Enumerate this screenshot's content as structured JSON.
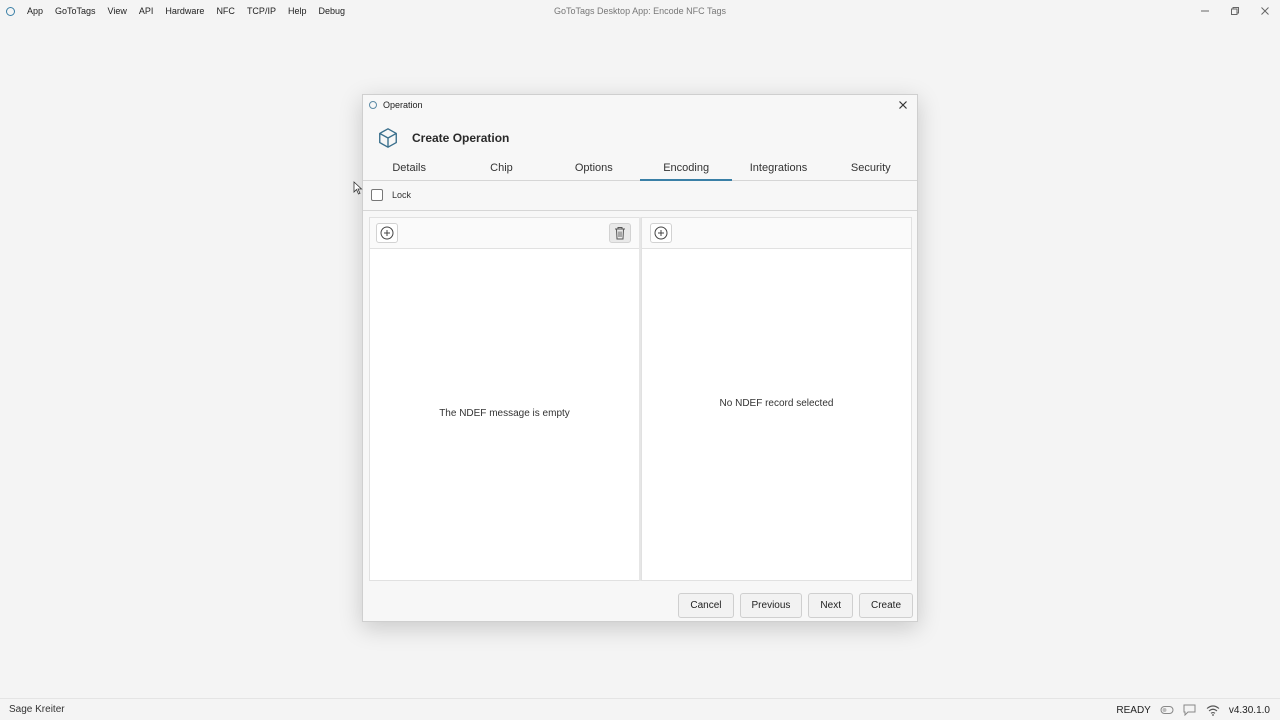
{
  "window": {
    "title": "GoToTags Desktop App: Encode NFC Tags",
    "menu": [
      "App",
      "GoToTags",
      "View",
      "API",
      "Hardware",
      "NFC",
      "TCP/IP",
      "Help",
      "Debug"
    ]
  },
  "dialog": {
    "title": "Operation",
    "heading": "Create Operation",
    "tabs": [
      "Details",
      "Chip",
      "Options",
      "Encoding",
      "Integrations",
      "Security"
    ],
    "active_tab": "Encoding",
    "lock_label": "Lock",
    "lock_checked": false,
    "left_pane_message": "The NDEF message is empty",
    "right_pane_message": "No NDEF record selected",
    "buttons": {
      "cancel": "Cancel",
      "previous": "Previous",
      "next": "Next",
      "create": "Create"
    }
  },
  "statusbar": {
    "user": "Sage Kreiter",
    "status": "READY",
    "version": "v4.30.1.0"
  },
  "colors": {
    "accent": "#3a7fa6",
    "background": "#f4f4f4"
  }
}
